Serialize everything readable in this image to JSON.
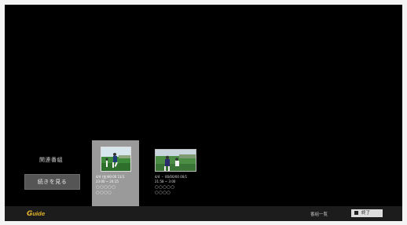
{
  "related": {
    "title": "関連番組",
    "continue_label": "続きを見る"
  },
  "cards": [
    {
      "meta_line1": "4/4 (金)00:00 11/1",
      "meta_line2": "23:00 ~ 24:15",
      "circles_line1": "○○○○○",
      "circles_line2": "○○○○",
      "selected": true
    },
    {
      "meta_line1": "4/4 ・ 00/00/00 00/1",
      "meta_line2": "21:58 ~ 3:00",
      "circles_line1": "○○○○○",
      "circles_line2": "○○○○",
      "selected": false
    }
  ],
  "footer": {
    "logo_g": "G",
    "logo_rest": "uide",
    "list_label": "番組一覧",
    "end_label": "終了",
    "end_icon": "stop-square-icon"
  },
  "colors": {
    "screen": "#000000",
    "selected_card": "#9a9a9a",
    "button": "#555555",
    "logo": "#c9a227"
  }
}
